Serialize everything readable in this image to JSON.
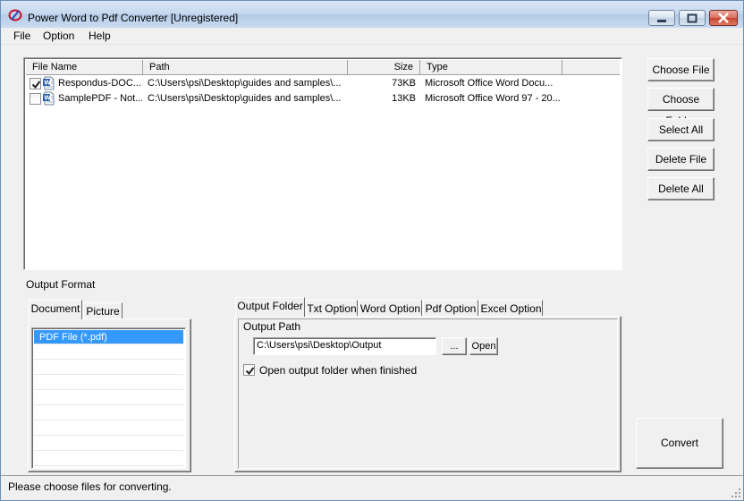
{
  "window": {
    "title": "Power Word to Pdf Converter [Unregistered]"
  },
  "menu": [
    "File",
    "Option",
    "Help"
  ],
  "file_list": {
    "columns": [
      "File Name",
      "Path",
      "Size",
      "Type"
    ],
    "rows": [
      {
        "checked": true,
        "name": "Respondus-DOC...",
        "path": "C:\\Users\\psi\\Desktop\\guides and samples\\...",
        "size": "73KB",
        "type": "Microsoft Office Word Docu..."
      },
      {
        "checked": false,
        "name": "SamplePDF - Not...",
        "path": "C:\\Users\\psi\\Desktop\\guides and samples\\...",
        "size": "13KB",
        "type": "Microsoft Office Word 97 - 20..."
      }
    ]
  },
  "side_buttons": [
    "Choose File",
    "Choose Folder",
    "Select All",
    "Delete File",
    "Delete All"
  ],
  "output_format": {
    "label": "Output Format",
    "tabs": [
      "Document",
      "Picture"
    ],
    "active_tab": "Document",
    "formats": [
      "PDF File  (*.pdf)"
    ],
    "selected_format": "PDF File  (*.pdf)"
  },
  "options": {
    "tabs": [
      "Output Folder",
      "Txt Option",
      "Word Option",
      "Pdf Option",
      "Excel Option"
    ],
    "active_tab": "Output Folder",
    "output_path_label": "Output Path",
    "output_path_value": "C:\\Users\\psi\\Desktop\\Output",
    "browse_label": "...",
    "open_label": "Open",
    "open_when_finished_label": "Open output folder when finished",
    "open_when_finished_checked": true
  },
  "convert_label": "Convert",
  "status": "Please choose files for converting.",
  "colors": {
    "selection": "#3399ff",
    "face": "#f0f0f0",
    "title_gradient_top": "#dbe7f5"
  }
}
